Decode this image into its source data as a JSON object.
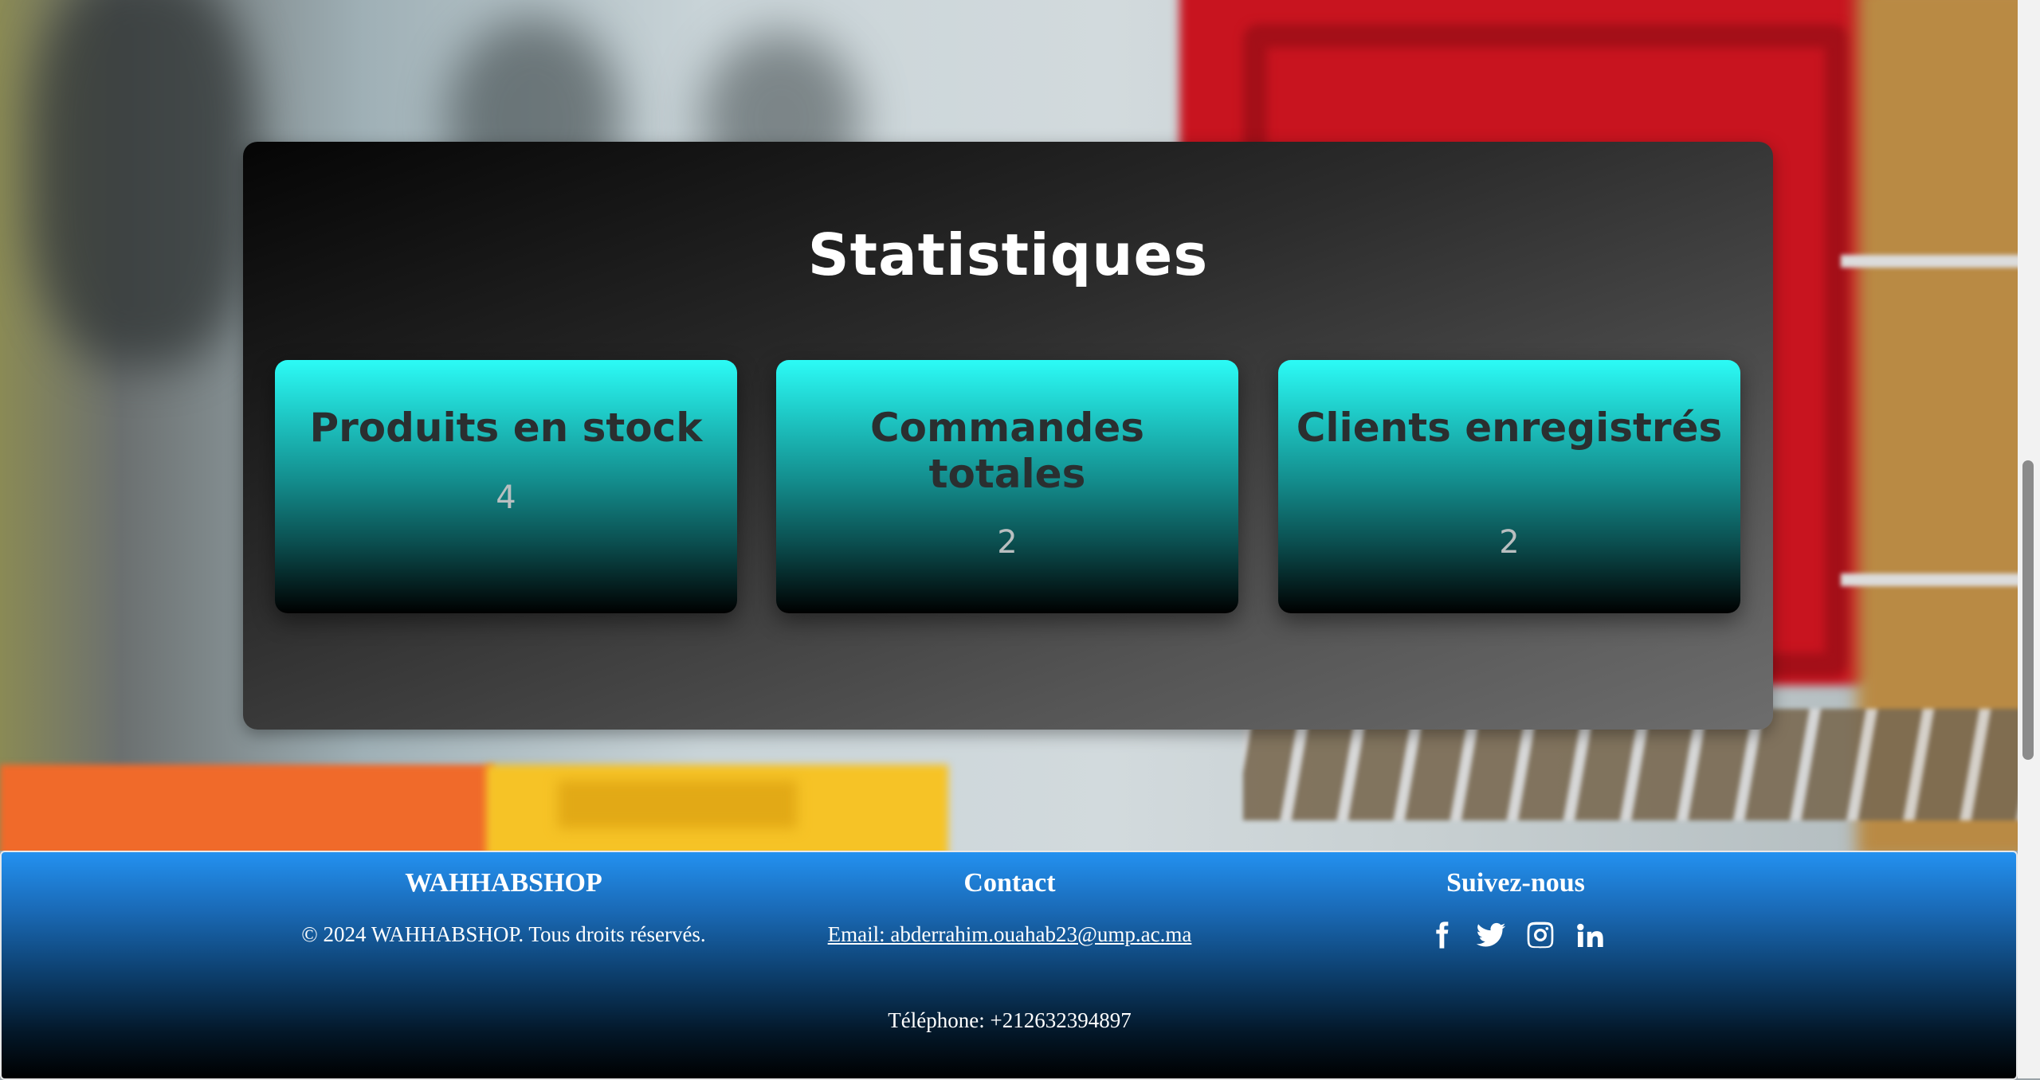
{
  "stats": {
    "title": "Statistiques",
    "cards": [
      {
        "label": "Produits en stock",
        "value": "4"
      },
      {
        "label": "Commandes totales",
        "value": "2"
      },
      {
        "label": "Clients enregistrés",
        "value": "2"
      }
    ]
  },
  "footer": {
    "brand": "WAHHABSHOP",
    "copyright": "© 2024 WAHHABSHOP. Tous droits réservés.",
    "contact_title": "Contact",
    "email": "Email: abderrahim.ouahab23@ump.ac.ma",
    "phone": "Téléphone: +212632394897",
    "social_title": "Suivez-nous",
    "social_icons": [
      "facebook-icon",
      "twitter-icon",
      "instagram-icon",
      "linkedin-icon"
    ]
  }
}
